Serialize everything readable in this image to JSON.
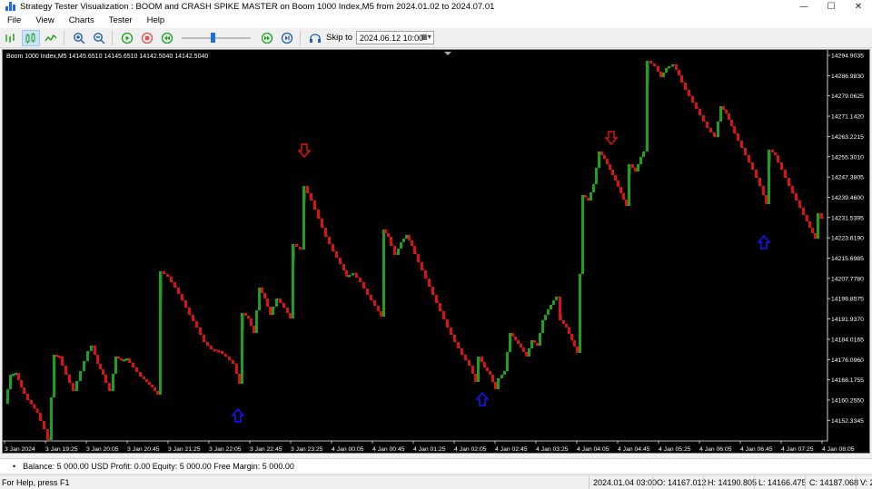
{
  "window": {
    "title": "Strategy Tester Visualization : BOOM and CRASH SPIKE MASTER on Boom 1000 Index,M5 from 2024.01.02 to 2024.07.01",
    "min_glyph": "—",
    "max_glyph": "☐",
    "close_glyph": "✕"
  },
  "menu": [
    "File",
    "View",
    "Charts",
    "Tester",
    "Help"
  ],
  "toolbar": {
    "skip_label": "Skip to",
    "skip_date": "2024.06.12 10:00",
    "speed_percent": 45
  },
  "chart": {
    "header": "Boom 1000 Index,M5  14145.6510  14145.6510  14142.5040  14142.5040",
    "price_ticks": [
      "14294.9035",
      "14286.9830",
      "14279.0625",
      "14271.1420",
      "14263.2215",
      "14255.3010",
      "14247.3805",
      "14239.4600",
      "14231.5395",
      "14223.6190",
      "14215.6985",
      "14207.7780",
      "14199.8575",
      "14191.9370",
      "14184.0165",
      "14176.0960",
      "14168.1755",
      "14160.2550",
      "14152.3345"
    ],
    "time_ticks": [
      "3 Jan 2024",
      "3 Jan 19:25",
      "3 Jan 20:05",
      "3 Jan 20:45",
      "3 Jan 21:25",
      "3 Jan 22:05",
      "3 Jan 22:45",
      "3 Jan 23:25",
      "4 Jan 00:05",
      "4 Jan 00:45",
      "4 Jan 01:25",
      "4 Jan 02:05",
      "4 Jan 02:45",
      "4 Jan 03:25",
      "4 Jan 04:05",
      "4 Jan 04:45",
      "4 Jan 05:25",
      "4 Jan 06:05",
      "4 Jan 06:45",
      "4 Jan 07:25",
      "4 Jan 08:05"
    ],
    "colors": {
      "bull": "#1aa31a",
      "bear": "#e01010",
      "up_arrow": "#1515ff",
      "down_arrow": "#e01010",
      "background": "#000000",
      "axis_text": "#ffffff"
    }
  },
  "status": {
    "bullet": "•",
    "account": "Balance: 5 000.00 USD  Profit: 0.00  Equity: 5 000.00  Free Margin: 5 000.00",
    "help": "For Help, press F1",
    "time": "2024.01.04 03:00",
    "open": "O: 14167.012",
    "high": "H: 14190.805",
    "low": "L: 14166.475",
    "close": "C: 14187.068",
    "volume": "V: 295"
  }
}
